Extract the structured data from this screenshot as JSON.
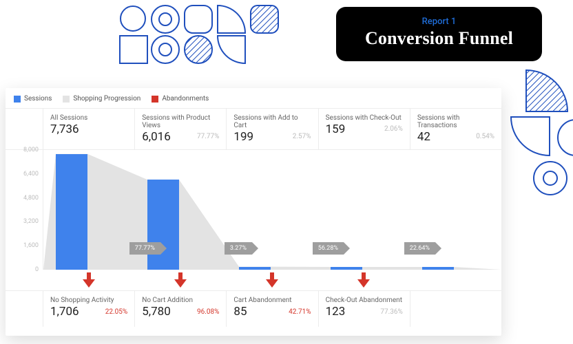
{
  "header": {
    "subtitle": "Report 1",
    "title": "Conversion Funnel"
  },
  "legend": {
    "sessions": {
      "label": "Sessions",
      "color": "#3f82ec"
    },
    "progression": {
      "label": "Shopping Progression",
      "color": "#e3e3e3"
    },
    "abandonments": {
      "label": "Abandonments",
      "color": "#d4352a"
    }
  },
  "y_axis": {
    "ticks": [
      "8,000",
      "6,400",
      "4,800",
      "3,200",
      "1,600",
      "0"
    ],
    "max": 8000
  },
  "stages": [
    {
      "label": "All Sessions",
      "value_str": "7,736",
      "value": 7736,
      "pct": ""
    },
    {
      "label": "Sessions with Product Views",
      "value_str": "6,016",
      "value": 6016,
      "pct": "77.77%"
    },
    {
      "label": "Sessions with Add to Cart",
      "value_str": "199",
      "value": 199,
      "pct": "2.57%"
    },
    {
      "label": "Sessions with Check-Out",
      "value_str": "159",
      "value": 159,
      "pct": "2.06%"
    },
    {
      "label": "Sessions with Transactions",
      "value_str": "42",
      "value": 42,
      "pct": "0.54%"
    }
  ],
  "flow_arrows": [
    "77.77%",
    "3.27%",
    "56.28%",
    "22.64%"
  ],
  "dropoffs": [
    {
      "label": "No Shopping Activity",
      "value_str": "1,706",
      "pct": "22.05%",
      "pct_color": "#d4352a"
    },
    {
      "label": "No Cart Addition",
      "value_str": "5,780",
      "pct": "96.08%",
      "pct_color": "#d4352a"
    },
    {
      "label": "Cart Abandonment",
      "value_str": "85",
      "pct": "42.71%",
      "pct_color": "#d4352a"
    },
    {
      "label": "Check-Out Abandonment",
      "value_str": "123",
      "pct": "77.36%",
      "pct_color": "#bcbcbc"
    }
  ],
  "chart_data": {
    "type": "bar",
    "title": "Conversion Funnel",
    "categories": [
      "All Sessions",
      "Sessions with Product Views",
      "Sessions with Add to Cart",
      "Sessions with Check-Out",
      "Sessions with Transactions"
    ],
    "values": [
      7736,
      6016,
      199,
      159,
      42
    ],
    "stage_pct_of_prev": [
      null,
      77.77,
      2.57,
      2.06,
      0.54
    ],
    "flow_pct": [
      77.77,
      3.27,
      56.28,
      22.64
    ],
    "dropoffs": [
      {
        "label": "No Shopping Activity",
        "value": 1706,
        "pct": 22.05
      },
      {
        "label": "No Cart Addition",
        "value": 5780,
        "pct": 96.08
      },
      {
        "label": "Cart Abandonment",
        "value": 85,
        "pct": 42.71
      },
      {
        "label": "Check-Out Abandonment",
        "value": 123,
        "pct": 77.36
      }
    ],
    "series": [
      {
        "name": "Sessions",
        "color": "#3f82ec"
      },
      {
        "name": "Shopping Progression",
        "color": "#e3e3e3"
      },
      {
        "name": "Abandonments",
        "color": "#d4352a"
      }
    ],
    "ylim": [
      0,
      8000
    ],
    "ylabel": "",
    "xlabel": ""
  }
}
